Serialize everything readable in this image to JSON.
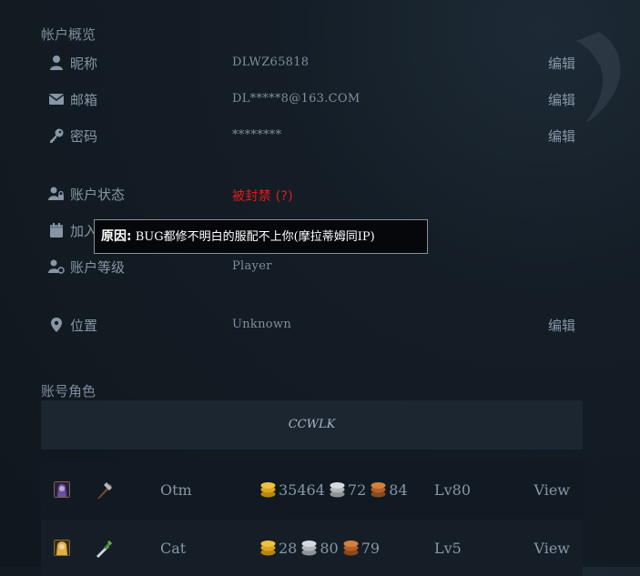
{
  "account_overview": {
    "title": "帐户概览",
    "rows": [
      {
        "label": "昵称",
        "value": "DLWZ65818",
        "edit": "编辑",
        "icon": "user-icon"
      },
      {
        "label": "邮箱",
        "value": "DL*****8@163.COM",
        "edit": "编辑",
        "icon": "envelope-icon"
      },
      {
        "label": "密码",
        "value": "********",
        "edit": "编辑",
        "icon": "key-icon"
      },
      {
        "label": "账户状态",
        "value": "被封禁 (?)",
        "icon": "user-lock-icon"
      },
      {
        "label": "加入",
        "icon": "calendar-icon"
      },
      {
        "label": "账户等级",
        "value": "Player",
        "icon": "user-tag-icon"
      },
      {
        "label": "位置",
        "value": "Unknown",
        "edit": "编辑",
        "icon": "map-marker-icon"
      }
    ]
  },
  "tooltip": {
    "prefix": "原因:",
    "text": "BUG都修不明白的服配不上你(摩拉蒂姆同IP)"
  },
  "characters": {
    "title": "账号角色",
    "realm": "CCWLK",
    "list": [
      {
        "name": "Otm",
        "gold": "35464",
        "silver": "72",
        "copper": "84",
        "level": "Lv80",
        "view": "View"
      },
      {
        "name": "Cat",
        "gold": "28",
        "silver": "80",
        "copper": "79",
        "level": "Lv5",
        "view": "View"
      }
    ]
  },
  "colors": {
    "banned": "#e21c1c",
    "gold": "#d9a520",
    "silver": "#c0c4c8",
    "copper": "#c8702a"
  }
}
